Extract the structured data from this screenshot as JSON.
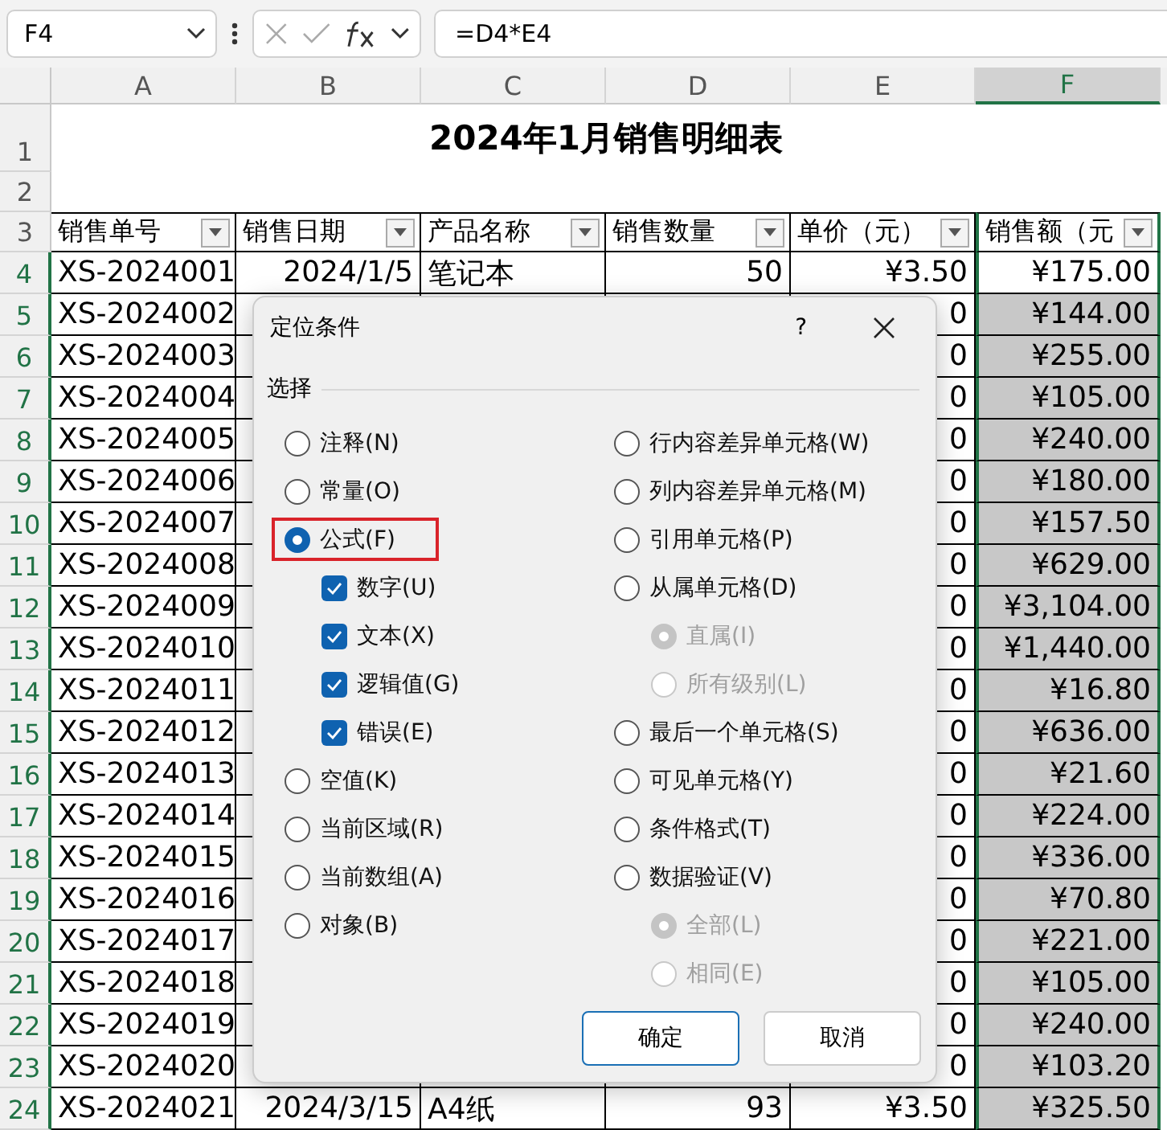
{
  "name_box": {
    "value": "F4"
  },
  "formula_bar": {
    "value": "=D4*E4"
  },
  "columns": [
    {
      "label": "A",
      "selected": false
    },
    {
      "label": "B",
      "selected": false
    },
    {
      "label": "C",
      "selected": false
    },
    {
      "label": "D",
      "selected": false
    },
    {
      "label": "E",
      "selected": false
    },
    {
      "label": "F",
      "selected": true
    }
  ],
  "sheet_rows": [
    {
      "kind": "title",
      "num": "1",
      "text": "2024年1月销售明细表"
    },
    {
      "kind": "blank",
      "num": "2"
    },
    {
      "kind": "header",
      "num": "3",
      "cells": [
        "销售单号",
        "销售日期",
        "产品名称",
        "销售数量",
        "单价（元）",
        "销售额（元"
      ]
    },
    {
      "kind": "data",
      "num": "4",
      "shaded": false,
      "a": "XS-2024001",
      "b": "2024/1/5",
      "c": "笔记本",
      "d": "50",
      "e": "¥3.50",
      "f": "¥175.00"
    },
    {
      "kind": "data",
      "num": "5",
      "shaded": true,
      "a": "XS-2024002",
      "e": "0",
      "f": "¥144.00"
    },
    {
      "kind": "data",
      "num": "6",
      "shaded": true,
      "a": "XS-2024003",
      "e": "0",
      "f": "¥255.00"
    },
    {
      "kind": "data",
      "num": "7",
      "shaded": true,
      "a": "XS-2024004",
      "e": "0",
      "f": "¥105.00"
    },
    {
      "kind": "data",
      "num": "8",
      "shaded": true,
      "a": "XS-2024005",
      "e": "0",
      "f": "¥240.00"
    },
    {
      "kind": "data",
      "num": "9",
      "shaded": true,
      "a": "XS-2024006",
      "e": "0",
      "f": "¥180.00"
    },
    {
      "kind": "data",
      "num": "10",
      "shaded": true,
      "a": "XS-2024007",
      "e": "0",
      "f": "¥157.50"
    },
    {
      "kind": "data",
      "num": "11",
      "shaded": true,
      "a": "XS-2024008",
      "e": "0",
      "f": "¥629.00"
    },
    {
      "kind": "data",
      "num": "12",
      "shaded": true,
      "a": "XS-2024009",
      "e": "0",
      "f": "¥3,104.00"
    },
    {
      "kind": "data",
      "num": "13",
      "shaded": true,
      "a": "XS-2024010",
      "e": "0",
      "f": "¥1,440.00"
    },
    {
      "kind": "data",
      "num": "14",
      "shaded": true,
      "a": "XS-2024011",
      "e": "0",
      "f": "¥16.80"
    },
    {
      "kind": "data",
      "num": "15",
      "shaded": true,
      "a": "XS-2024012",
      "e": "0",
      "f": "¥636.00"
    },
    {
      "kind": "data",
      "num": "16",
      "shaded": true,
      "a": "XS-2024013",
      "e": "0",
      "f": "¥21.60"
    },
    {
      "kind": "data",
      "num": "17",
      "shaded": true,
      "a": "XS-2024014",
      "e": "0",
      "f": "¥224.00"
    },
    {
      "kind": "data",
      "num": "18",
      "shaded": true,
      "a": "XS-2024015",
      "e": "0",
      "f": "¥336.00"
    },
    {
      "kind": "data",
      "num": "19",
      "shaded": true,
      "a": "XS-2024016",
      "e": "0",
      "f": "¥70.80"
    },
    {
      "kind": "data",
      "num": "20",
      "shaded": true,
      "a": "XS-2024017",
      "e": "0",
      "f": "¥221.00"
    },
    {
      "kind": "data",
      "num": "21",
      "shaded": true,
      "a": "XS-2024018",
      "e": "0",
      "f": "¥105.00"
    },
    {
      "kind": "data",
      "num": "22",
      "shaded": true,
      "a": "XS-2024019",
      "e": "0",
      "f": "¥240.00"
    },
    {
      "kind": "data",
      "num": "23",
      "shaded": true,
      "a": "XS-2024020",
      "e": "0",
      "f": "¥103.20"
    },
    {
      "kind": "data",
      "num": "24",
      "shaded": true,
      "a": "XS-2024021",
      "b": "2024/3/15",
      "c": "A4纸",
      "d": "93",
      "e": "¥3.50",
      "f": "¥325.50"
    }
  ],
  "dialog": {
    "title": "定位条件",
    "help": "?",
    "group_label": "选择",
    "left_options": [
      {
        "kind": "radio",
        "label": "注释(N)",
        "selected": false
      },
      {
        "kind": "radio",
        "label": "常量(O)",
        "selected": false
      },
      {
        "kind": "radio",
        "label": "公式(F)",
        "selected": true,
        "highlighted": true
      },
      {
        "kind": "checkbox",
        "label": "数字(U)",
        "checked": true
      },
      {
        "kind": "checkbox",
        "label": "文本(X)",
        "checked": true
      },
      {
        "kind": "checkbox",
        "label": "逻辑值(G)",
        "checked": true
      },
      {
        "kind": "checkbox",
        "label": "错误(E)",
        "checked": true
      },
      {
        "kind": "radio",
        "label": "空值(K)",
        "selected": false
      },
      {
        "kind": "radio",
        "label": "当前区域(R)",
        "selected": false
      },
      {
        "kind": "radio",
        "label": "当前数组(A)",
        "selected": false
      },
      {
        "kind": "radio",
        "label": "对象(B)",
        "selected": false
      }
    ],
    "right_options": [
      {
        "kind": "radio",
        "label": "行内容差异单元格(W)",
        "selected": false
      },
      {
        "kind": "radio",
        "label": "列内容差异单元格(M)",
        "selected": false
      },
      {
        "kind": "radio",
        "label": "引用单元格(P)",
        "selected": false
      },
      {
        "kind": "radio",
        "label": "从属单元格(D)",
        "selected": false
      },
      {
        "kind": "subradio",
        "label": "直属(I)",
        "selected": true,
        "disabled": true
      },
      {
        "kind": "subradio",
        "label": "所有级别(L)",
        "selected": false,
        "disabled": true
      },
      {
        "kind": "radio",
        "label": "最后一个单元格(S)",
        "selected": false
      },
      {
        "kind": "radio",
        "label": "可见单元格(Y)",
        "selected": false
      },
      {
        "kind": "radio",
        "label": "条件格式(T)",
        "selected": false
      },
      {
        "kind": "radio",
        "label": "数据验证(V)",
        "selected": false
      },
      {
        "kind": "subradio",
        "label": "全部(L)",
        "selected": true,
        "disabled": true
      },
      {
        "kind": "subradio",
        "label": "相同(E)",
        "selected": false,
        "disabled": true
      }
    ],
    "buttons": [
      {
        "label": "确定",
        "primary": true
      },
      {
        "label": "取消",
        "primary": false
      }
    ]
  }
}
